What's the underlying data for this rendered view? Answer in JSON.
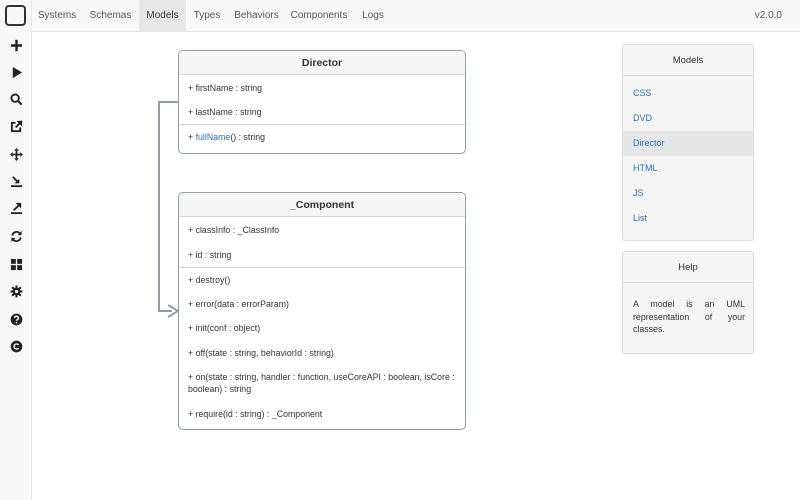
{
  "navbar": {
    "items": [
      {
        "label": "Systems"
      },
      {
        "label": "Schemas"
      },
      {
        "label": "Models",
        "active": true
      },
      {
        "label": "Types"
      },
      {
        "label": "Behaviors"
      },
      {
        "label": "Components"
      },
      {
        "label": "Logs"
      }
    ],
    "version": "v2.0.0"
  },
  "toolbar": {
    "icons": [
      "plus-icon",
      "play-icon",
      "search-icon",
      "external-link-icon",
      "move-icon",
      "import-icon",
      "export-icon",
      "refresh-icon",
      "grid-icon",
      "gear-icon",
      "question-icon",
      "copyright-icon"
    ]
  },
  "models": {
    "director": {
      "title": "Director",
      "properties": [
        "+ firstName : string",
        "+ lastName : string"
      ],
      "method": {
        "prefix": "+ ",
        "name": "fullName",
        "suffix": "() : string"
      }
    },
    "component": {
      "title": "_Component",
      "properties": [
        "+ classInfo : _ClassInfo",
        "+ id : string"
      ],
      "methods": [
        "+ destroy()",
        "+ error(data : errorParam)",
        "+ init(conf : object)",
        "+ off(state : string, behaviorId : string)",
        "+ on(state : string, handler : function, useCoreAPI : boolean, isCore : boolean) : string",
        "+ require(id : string) : _Component"
      ]
    }
  },
  "models_panel": {
    "title": "Models",
    "items": [
      "CSS",
      "DVD",
      "Director",
      "HTML",
      "JS",
      "List"
    ],
    "selected": "Director"
  },
  "help_panel": {
    "title": "Help",
    "text": "A model is an UML representation of your classes."
  },
  "colors": {
    "link": "#2a6db7",
    "connector": "#8f9ea6",
    "active_nav": "#e7e7e7"
  }
}
